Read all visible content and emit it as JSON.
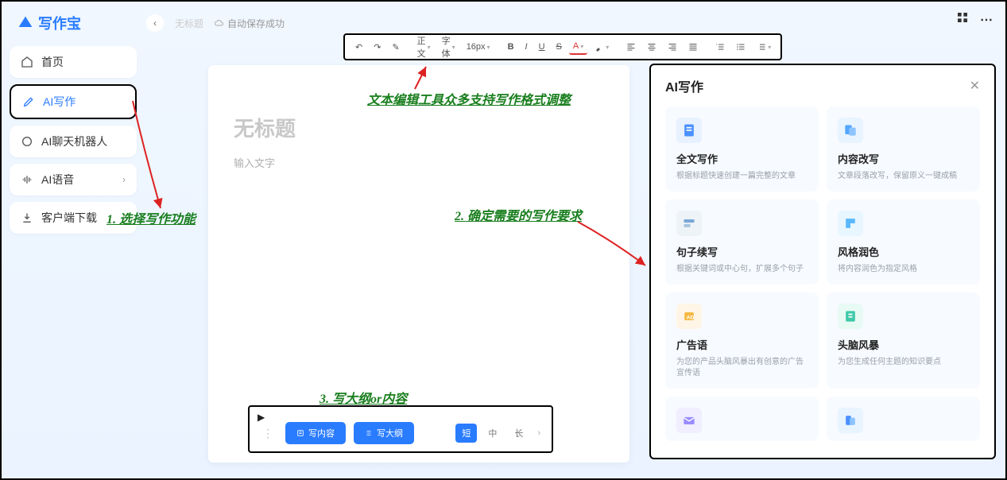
{
  "app": {
    "name": "写作宝"
  },
  "sidebar": {
    "items": [
      {
        "label": "首页"
      },
      {
        "label": "AI写作"
      },
      {
        "label": "AI聊天机器人"
      },
      {
        "label": "AI语音"
      },
      {
        "label": "客户端下载"
      }
    ]
  },
  "topbar": {
    "untitled": "无标题",
    "autosave": "自动保存成功"
  },
  "toolbar": {
    "zhengwen": "正文",
    "ziti": "字体",
    "size": "16px",
    "bold": "B",
    "italic": "I",
    "underline": "U",
    "strike": "S",
    "textcolor": "A"
  },
  "doc": {
    "title_placeholder": "无标题",
    "body_placeholder": "输入文字"
  },
  "ai_panel": {
    "title": "AI写作",
    "cards": [
      {
        "title": "全文写作",
        "desc": "根据标题快速创建一篇完整的文章",
        "icon_color": "#4a90ff"
      },
      {
        "title": "内容改写",
        "desc": "文章段落改写，保留原义一键成稿",
        "icon_color": "#55a6ff"
      },
      {
        "title": "句子续写",
        "desc": "根据关键词或中心句，扩展多个句子",
        "icon_color": "#7aa8d8"
      },
      {
        "title": "风格润色",
        "desc": "将内容润色为指定风格",
        "icon_color": "#5bb8ff"
      },
      {
        "title": "广告语",
        "desc": "为您的产品头脑风暴出有创意的广告宣传语",
        "icon_color": "#f5b942"
      },
      {
        "title": "头脑风暴",
        "desc": "为您生成任何主题的知识要点",
        "icon_color": "#3fc9a8"
      }
    ]
  },
  "action_bar": {
    "write_content": "写内容",
    "write_outline": "写大纲",
    "len_short": "短",
    "len_mid": "中",
    "len_long": "长"
  },
  "annotations": {
    "a1": "1. 选择写作功能",
    "a2": "2. 确定需要的写作要求",
    "a3": "3. 写大纲or内容",
    "toolbar_note": "文本编辑工具众多支持写作格式调整"
  }
}
